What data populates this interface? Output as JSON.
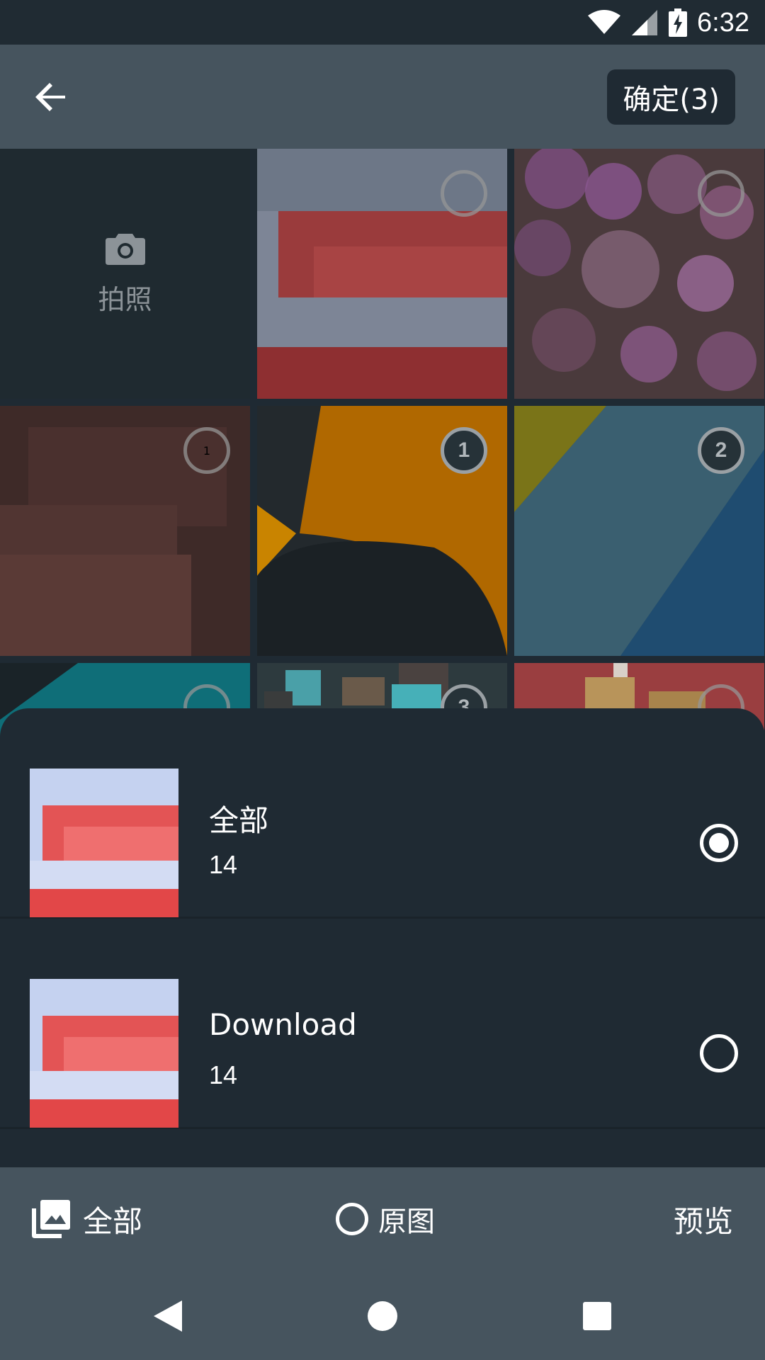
{
  "status_bar": {
    "time": "6:32",
    "icons": [
      "wifi-icon",
      "signal-icon",
      "battery-charging-icon"
    ]
  },
  "toolbar": {
    "back_icon": "arrow-back-icon",
    "confirm_label": "确定(3)"
  },
  "grid": {
    "camera_label": "拍照",
    "camera_icon": "camera-icon",
    "selections": [
      "",
      "",
      "",
      "1",
      "2",
      "",
      "3",
      ""
    ]
  },
  "albums": [
    {
      "name": "全部",
      "count": "14",
      "selected": true
    },
    {
      "name": "Download",
      "count": "14",
      "selected": false
    }
  ],
  "bottom_bar": {
    "album_label": "全部",
    "original_label": "原图",
    "preview_label": "预览"
  },
  "nav_bar": {
    "icons": [
      "back-triangle-icon",
      "home-circle-icon",
      "recents-square-icon"
    ]
  },
  "colors": {
    "toolbar": "#46545e",
    "sheet": "#1f2a33",
    "status_bar": "#202b33"
  }
}
